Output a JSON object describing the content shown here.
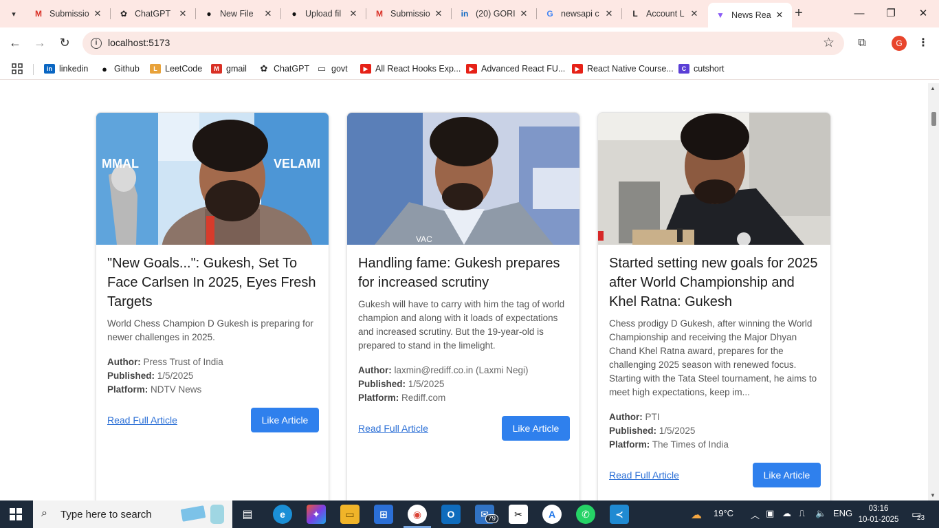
{
  "browser": {
    "tabs": [
      {
        "title": "Submissio",
        "icon": "gmail-icon",
        "color": "#d93025"
      },
      {
        "title": "ChatGPT",
        "icon": "chatgpt-icon",
        "color": "#222222"
      },
      {
        "title": "New File",
        "icon": "github-icon",
        "color": "#111111"
      },
      {
        "title": "Upload fil",
        "icon": "github-icon",
        "color": "#111111"
      },
      {
        "title": "Submissio",
        "icon": "gmail-icon",
        "color": "#d93025"
      },
      {
        "title": "(20) GORI",
        "icon": "linkedin-icon",
        "color": "#0a66c2"
      },
      {
        "title": "newsapi c",
        "icon": "google-icon",
        "color": "#4285f4"
      },
      {
        "title": "Account L",
        "icon": "leetcode-icon",
        "color": "#222222"
      },
      {
        "title": "News Rea",
        "icon": "vite-icon",
        "color": "#8b5cf6",
        "active": true
      }
    ],
    "url": "localhost:5173",
    "profile_initial": "G",
    "bookmarks": [
      {
        "label": "linkedin",
        "icon": "linkedin-icon",
        "color": "#0a66c2",
        "glyph": "in"
      },
      {
        "label": "Github",
        "icon": "github-icon",
        "color": "#111111",
        "glyph": "●"
      },
      {
        "label": "LeetCode",
        "icon": "leetcode-icon",
        "color": "#e8a23a",
        "glyph": "L"
      },
      {
        "label": "gmail",
        "icon": "gmail-icon",
        "color": "#d93025",
        "glyph": "M"
      },
      {
        "label": "ChatGPT",
        "icon": "chatgpt-icon",
        "color": "#222222",
        "glyph": "✿"
      },
      {
        "label": "govt",
        "icon": "folder-icon",
        "color": "#444444",
        "glyph": "▭"
      },
      {
        "label": "All React Hooks Exp...",
        "icon": "youtube-icon",
        "color": "#e62117",
        "glyph": "▶"
      },
      {
        "label": "Advanced React FU...",
        "icon": "youtube-icon",
        "color": "#e62117",
        "glyph": "▶"
      },
      {
        "label": "React Native Course...",
        "icon": "youtube-icon",
        "color": "#e62117",
        "glyph": "▶"
      },
      {
        "label": "cutshort",
        "icon": "cutshort-icon",
        "color": "#5b3fd6",
        "glyph": "C"
      }
    ]
  },
  "articles": [
    {
      "title": "\"New Goals...\": Gukesh, Set To Face Carlsen In 2025, Eyes Fresh Targets",
      "description": "World Chess Champion D Gukesh is preparing for newer challenges in 2025.",
      "author_label": "Author:",
      "author": "Press Trust of India",
      "published_label": "Published:",
      "published": "1/5/2025",
      "platform_label": "Platform:",
      "platform": "NDTV News",
      "read_label": "Read Full Article",
      "like_label": "Like Article"
    },
    {
      "title": "Handling fame: Gukesh prepares for increased scrutiny",
      "description": "Gukesh will have to carry with him the tag of world champion and along with it loads of expectations and increased scrutiny. But the 19-year-old is prepared to stand in the limelight.",
      "author_label": "Author:",
      "author": "laxmin@rediff.co.in (Laxmi Negi)",
      "published_label": "Published:",
      "published": "1/5/2025",
      "platform_label": "Platform:",
      "platform": "Rediff.com",
      "read_label": "Read Full Article",
      "like_label": "Like Article"
    },
    {
      "title": "Started setting new goals for 2025 after World Championship and Khel Ratna: Gukesh",
      "description": "Chess prodigy D Gukesh, after winning the World Championship and receiving the Major Dhyan Chand Khel Ratna award, prepares for the challenging 2025 season with renewed focus. Starting with the Tata Steel tournament, he aims to meet high expectations, keep im...",
      "author_label": "Author:",
      "author": "PTI",
      "published_label": "Published:",
      "published": "1/5/2025",
      "platform_label": "Platform:",
      "platform": "The Times of India",
      "read_label": "Read Full Article",
      "like_label": "Like Article"
    }
  ],
  "taskbar": {
    "search_placeholder": "Type here to search",
    "weather": "19°C",
    "language": "ENG",
    "time": "03:16",
    "date": "10-01-2025",
    "mail_badge": "79",
    "notification_count": "23"
  }
}
